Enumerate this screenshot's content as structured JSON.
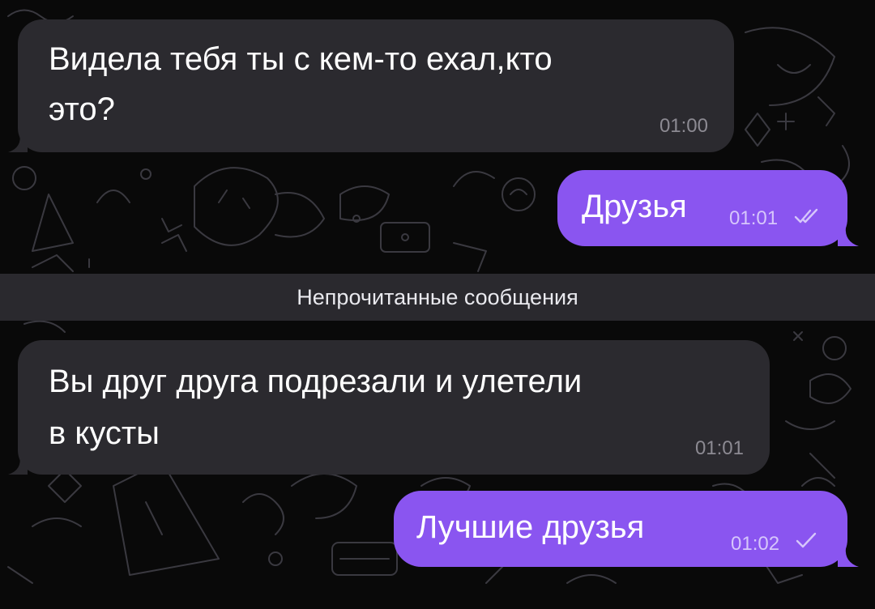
{
  "messages": [
    {
      "direction": "incoming",
      "text_line1": "Видела тебя ты с кем-то ехал,кто",
      "text_line2": "это?",
      "time": "01:00"
    },
    {
      "direction": "outgoing",
      "text": "Друзья",
      "time": "01:01",
      "status": "read",
      "status_icon": "double-check-icon"
    },
    {
      "direction": "incoming",
      "text_line1": "Вы друг друга подрезали и улетели",
      "text_line2": "в кусты",
      "time": "01:01"
    },
    {
      "direction": "outgoing",
      "text": "Лучшие друзья",
      "time": "01:02",
      "status": "sent",
      "status_icon": "check-icon"
    }
  ],
  "unread_divider": {
    "label": "Непрочитанные сообщения"
  },
  "colors": {
    "background": "#090909",
    "incoming_bubble": "#2b2a2f",
    "outgoing_bubble": "#8a55f0",
    "unread_bar": "#2a292e"
  }
}
